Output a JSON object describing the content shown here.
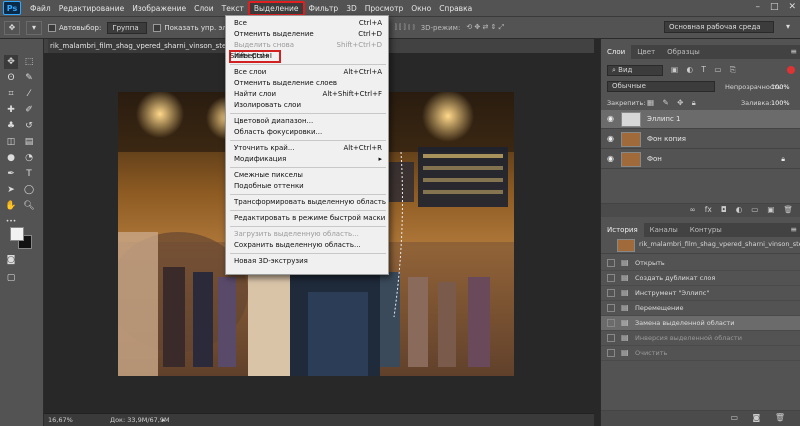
{
  "app": {
    "logo": "Ps"
  },
  "menubar": {
    "items": [
      "Файл",
      "Редактирование",
      "Изображение",
      "Слои",
      "Текст",
      "Выделение",
      "Фильтр",
      "3D",
      "Просмотр",
      "Окно",
      "Справка"
    ],
    "active_index": 5
  },
  "window_controls": [
    "–",
    "□",
    "✕"
  ],
  "optbar": {
    "autoselect_label": "Автовыбор:",
    "autoselect_value": "Группа",
    "show_controls_label": "Показать упр. элем.",
    "mode_3d_label": "3D-режим:",
    "workspace": "Основная рабочая среда"
  },
  "document": {
    "tab_label": "rik_malambri_film_shag_vpered_sharni_vinson_step_up_3...",
    "zoom": "16,67%",
    "doc_info": "Док: 33,9M/67,9M"
  },
  "colors": {
    "selected_layer_bg": "#6b6b6b",
    "highlight_red": "#e02020",
    "fg": "#f2f2f2",
    "bg": "#111111"
  },
  "dropdown": {
    "items": [
      {
        "label": "Все",
        "shortcut": "Ctrl+A"
      },
      {
        "label": "Отменить выделение",
        "shortcut": "Ctrl+D"
      },
      {
        "label": "Выделить снова",
        "shortcut": "Shift+Ctrl+D",
        "disabled": true
      },
      {
        "label": "Инверсия",
        "shortcut": "Shift+Ctrl+I",
        "boxed": true
      },
      {
        "label": "Все слои",
        "shortcut": "Alt+Ctrl+A"
      },
      {
        "label": "Отменить выделение слоев",
        "shortcut": ""
      },
      {
        "label": "Найти слои",
        "shortcut": "Alt+Shift+Ctrl+F"
      },
      {
        "label": "Изолировать слои",
        "shortcut": ""
      },
      {
        "label": "Цветовой диапазон...",
        "shortcut": ""
      },
      {
        "label": "Область фокусировки...",
        "shortcut": ""
      },
      {
        "label": "Уточнить край...",
        "shortcut": "Alt+Ctrl+R"
      },
      {
        "label": "Модификация",
        "shortcut": "▸"
      },
      {
        "label": "Смежные пикселы",
        "shortcut": ""
      },
      {
        "label": "Подобные оттенки",
        "shortcut": ""
      },
      {
        "label": "Трансформировать выделенную область",
        "shortcut": ""
      },
      {
        "label": "Редактировать в режиме быстрой маски",
        "shortcut": ""
      },
      {
        "label": "Загрузить выделенную область...",
        "shortcut": "",
        "disabled": true
      },
      {
        "label": "Сохранить выделенную область...",
        "shortcut": ""
      },
      {
        "label": "Новая 3D-экструзия",
        "shortcut": ""
      }
    ]
  },
  "layers_panel": {
    "tabs": [
      "Слои",
      "Цвет",
      "Образцы"
    ],
    "kind_filter": "Вид",
    "blend_mode": "Обычные",
    "opacity_label": "Непрозрачность:",
    "opacity_value": "100%",
    "lock_label": "Закрепить:",
    "fill_label": "Заливка:",
    "fill_value": "100%",
    "layers": [
      {
        "name": "Эллипс 1",
        "selected": true
      },
      {
        "name": "Фон копия",
        "selected": false
      },
      {
        "name": "Фон",
        "selected": false,
        "locked": true
      }
    ],
    "footer_icons": [
      "link-icon",
      "fx-icon",
      "mask-icon",
      "adjustment-icon",
      "folder-icon",
      "new-layer-icon",
      "trash-icon"
    ],
    "footer_glyphs": [
      "∞",
      "fx",
      "◘",
      "◐",
      "▭",
      "▣",
      "🗑"
    ]
  },
  "history_panel": {
    "tabs": [
      "История",
      "Каналы",
      "Контуры"
    ],
    "snapshot": "rik_malambri_film_shag_vpered_sharni_vinson_step_...",
    "items": [
      {
        "label": "Открыть",
        "state": "normal"
      },
      {
        "label": "Создать дубликат слоя",
        "state": "normal"
      },
      {
        "label": "Инструмент \"Эллипс\"",
        "state": "normal"
      },
      {
        "label": "Перемещение",
        "state": "normal"
      },
      {
        "label": "Замена выделенной области",
        "state": "selected"
      },
      {
        "label": "Инверсия выделенной области",
        "state": "dim"
      },
      {
        "label": "Очистить",
        "state": "dim"
      }
    ]
  }
}
